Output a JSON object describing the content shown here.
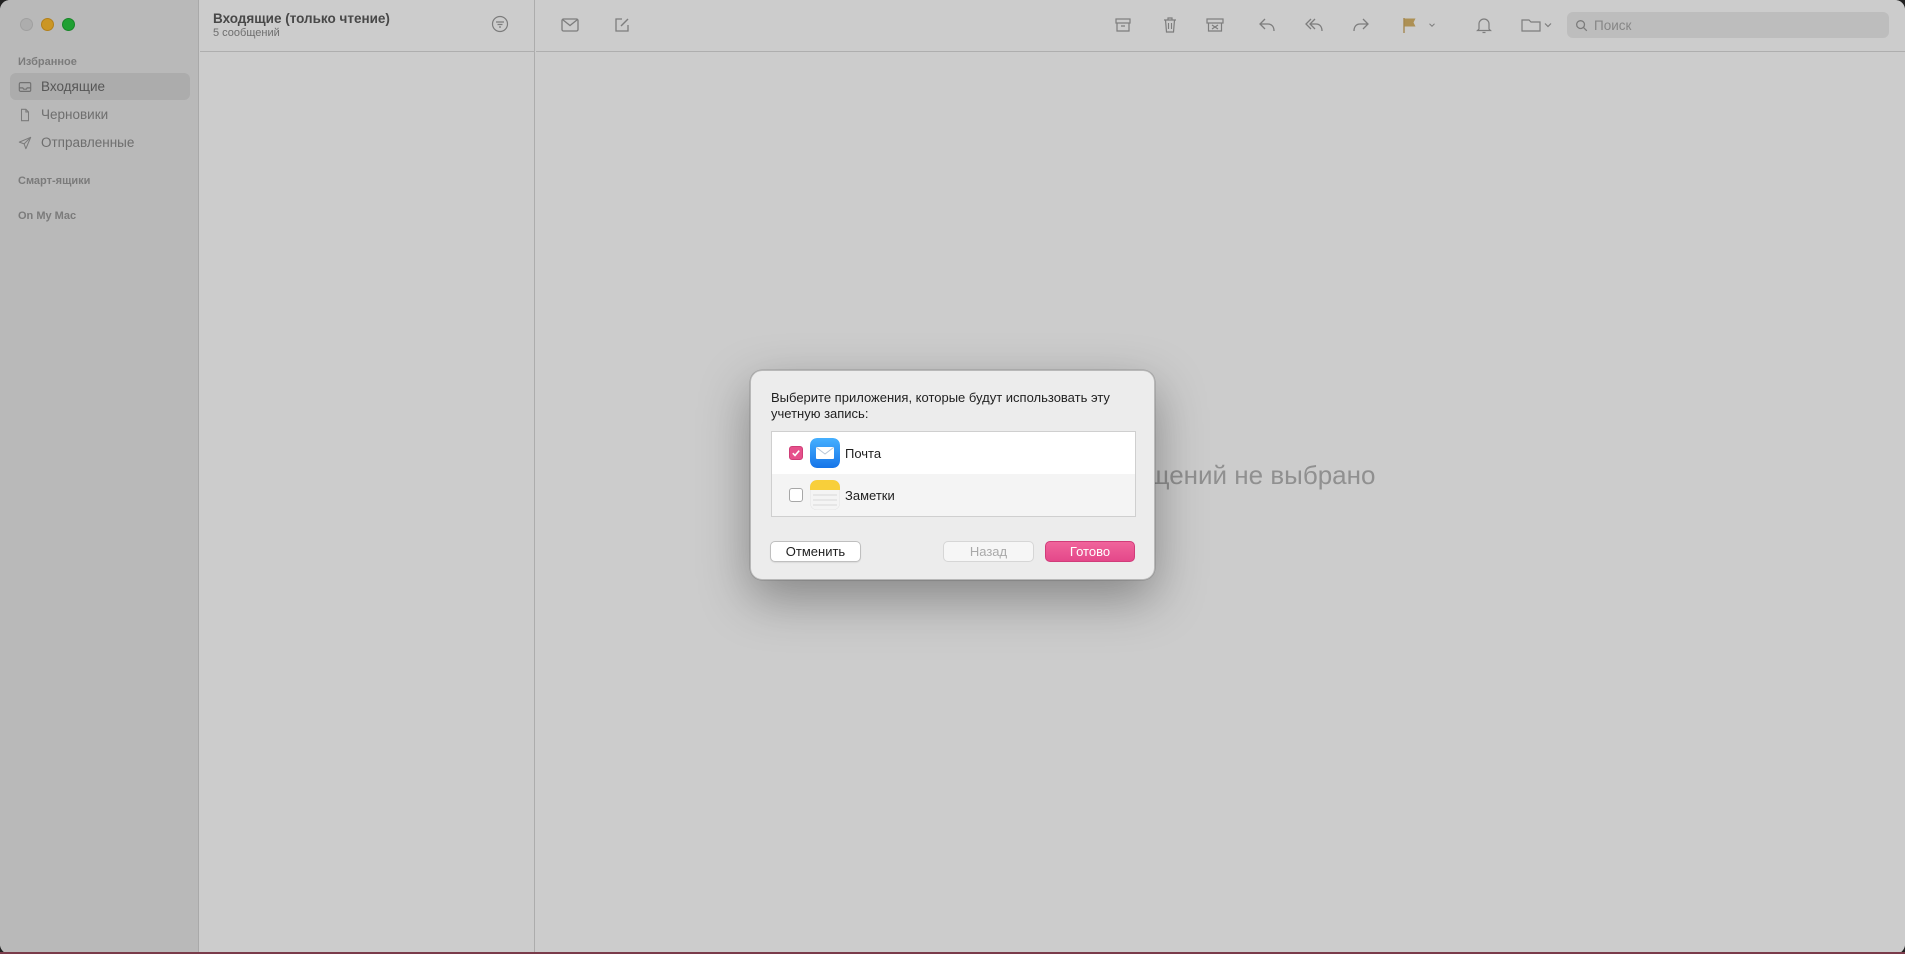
{
  "window": {
    "traffic_lights": [
      "close",
      "minimize",
      "maximize"
    ]
  },
  "sidebar": {
    "favorites_title": "Избранное",
    "items": [
      {
        "label": "Входящие",
        "icon": "inbox-icon",
        "active": true
      },
      {
        "label": "Черновики",
        "icon": "document-icon",
        "active": false
      },
      {
        "label": "Отправленные",
        "icon": "paperplane-icon",
        "active": false
      }
    ],
    "smart_mailboxes_title": "Смарт-ящики",
    "on_my_mac_title": "On My Mac"
  },
  "message_list": {
    "title": "Входящие (только чтение)",
    "subtitle": "5 сообщений"
  },
  "toolbar": {
    "icons": [
      "get-mail-icon",
      "compose-icon",
      "archive-icon",
      "trash-icon",
      "junk-icon",
      "reply-icon",
      "reply-all-icon",
      "forward-icon",
      "flag-icon",
      "flag-menu-chevron-icon",
      "mute-icon",
      "move-to-folder-icon"
    ],
    "search_placeholder": "Поиск"
  },
  "viewer": {
    "empty_text": "Сообщений не выбрано"
  },
  "dialog": {
    "prompt": "Выберите приложения, которые будут использовать эту учетную запись:",
    "apps": [
      {
        "name": "Почта",
        "checked": true,
        "icon": "mail-app-icon"
      },
      {
        "name": "Заметки",
        "checked": false,
        "icon": "notes-app-icon"
      }
    ],
    "cancel_label": "Отменить",
    "back_label": "Назад",
    "done_label": "Готово"
  },
  "colors": {
    "accent": "#e6508b",
    "overlay": "rgba(0,0,0,0.2)"
  }
}
